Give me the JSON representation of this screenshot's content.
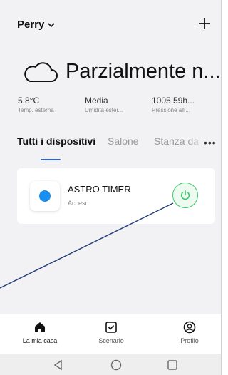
{
  "header": {
    "home_name": "Perry",
    "chevron_icon": "chevron-down-icon",
    "add_icon": "plus-icon"
  },
  "weather": {
    "icon": "cloud-icon",
    "condition": "Parzialmente n..."
  },
  "metrics": [
    {
      "value": "5.8°C",
      "label": "Temp. esterna"
    },
    {
      "value": "Media",
      "label": "Umidità ester..."
    },
    {
      "value": "1005.59h...",
      "label": "Pressione all'..."
    }
  ],
  "tabs": [
    {
      "label": "Tutti i dispositivi",
      "active": true
    },
    {
      "label": "Salone",
      "active": false
    },
    {
      "label": "Stanza da",
      "active": false
    }
  ],
  "more_label": "•••",
  "device": {
    "name": "ASTRO TIMER",
    "status": "Acceso",
    "icon": "device-dot-icon",
    "power_icon": "power-icon",
    "power_color": "#3fc86a"
  },
  "bottom_nav": [
    {
      "label": "La mia casa",
      "icon": "home-icon",
      "active": true
    },
    {
      "label": "Scenario",
      "icon": "checkbox-icon",
      "active": false
    },
    {
      "label": "Profilo",
      "icon": "profile-icon",
      "active": false
    }
  ],
  "system_nav": {
    "back_icon": "back-triangle-icon",
    "home_icon": "home-circle-icon",
    "recents_icon": "recents-square-icon"
  },
  "colors": {
    "accent": "#2d63d7",
    "power_on": "#3fc86a",
    "device_blue": "#1a8ff0",
    "annotation_line": "#27407a"
  }
}
